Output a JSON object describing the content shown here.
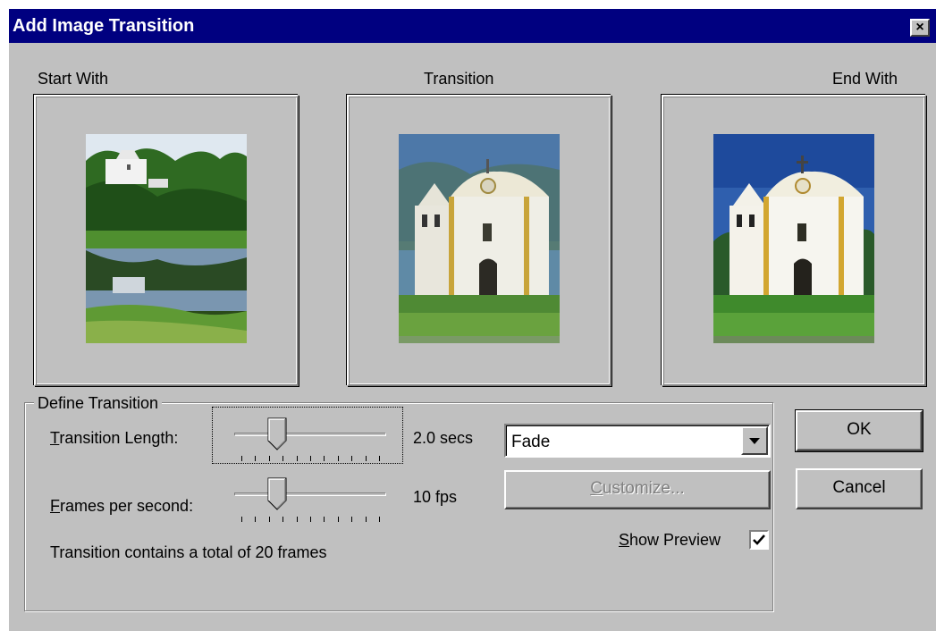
{
  "window": {
    "title": "Add Image Transition",
    "close_label": "×"
  },
  "panels": {
    "start_label": "Start With",
    "transition_label": "Transition",
    "end_label": "End With"
  },
  "define": {
    "group_title": "Define Transition",
    "length_label_first": "T",
    "length_label_rest": "ransition Length:",
    "length_value": "2.0 secs",
    "length_position": 0.25,
    "fps_label_first": "F",
    "fps_label_rest": "rames per second:",
    "fps_value": "10 fps",
    "fps_position": 0.25,
    "total_text": "Transition contains a total of 20 frames"
  },
  "effect": {
    "selected": "Fade",
    "customize_first": "C",
    "customize_rest": "ustomize...",
    "show_preview_first": "S",
    "show_preview_rest": "how Preview",
    "show_preview_checked": true
  },
  "buttons": {
    "ok": "OK",
    "cancel": "Cancel"
  },
  "icons": {
    "dropdown": "chevron-down-icon",
    "check": "check-icon",
    "close": "close-icon"
  }
}
